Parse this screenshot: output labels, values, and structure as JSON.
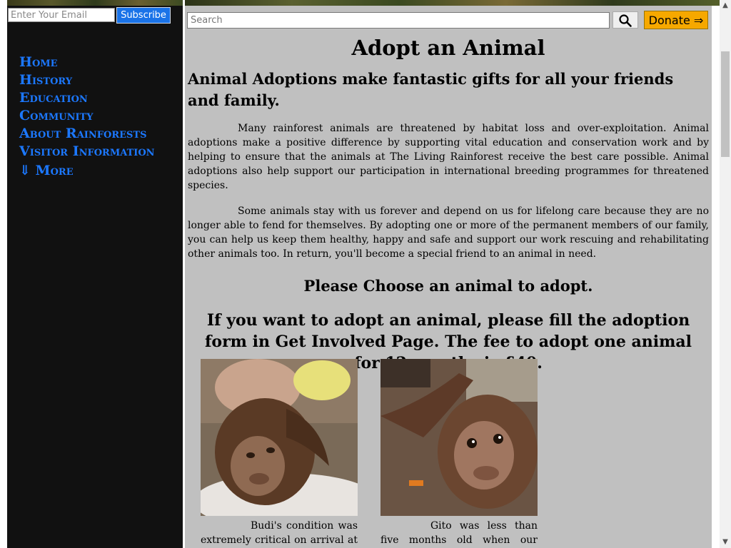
{
  "sidebar": {
    "subscribe": {
      "email_placeholder": "Enter Your Email",
      "button_label": "Subscribe"
    },
    "nav": {
      "items": [
        {
          "label": "Home"
        },
        {
          "label": "History"
        },
        {
          "label": "Education"
        },
        {
          "label": "Community"
        },
        {
          "label": "About Rainforests"
        },
        {
          "label": "Visitor Information"
        }
      ],
      "more_label": "⇓ More"
    }
  },
  "header": {
    "search_placeholder": "Search",
    "search_icon": "search-icon",
    "donate_label": "Donate ⇒"
  },
  "main": {
    "title": "Adopt an Animal",
    "subtitle": "Animal Adoptions make fantastic gifts for all your friends and family.",
    "paragraphs": [
      "Many rainforest animals are threatened by habitat loss and over-exploitation. Animal adoptions make a positive difference by supporting vital education and conservation work and by helping to ensure that the animals at The Living Rainforest receive the best care possible. Animal adoptions also help support our participation in international breeding programmes for threatened species.",
      "Some animals stay with us forever and depend on us for lifelong care because they are no longer able to fend for themselves. By adopting one or more of the permanent members of our family, you can help us keep them healthy, happy and safe and support our work rescuing and rehabilitating other animals too. In return, you'll become a special friend to an animal in need."
    ],
    "choose_heading": "Please Choose an animal to adopt.",
    "instructions": "If you want to adopt an animal, please fill the adoption form in Get Involved Page. The fee to adopt one animal for 12 months is £40.",
    "animals": [
      {
        "caption": "Budi's condition was extremely critical on arrival at the"
      },
      {
        "caption": "Gito was less than five months old when our rescue team"
      }
    ]
  },
  "colors": {
    "sidebar_bg": "#111111",
    "nav_link": "#1c78ff",
    "main_bg": "#c0c0c0",
    "subscribe_bg": "#1a73e8",
    "donate_bg": "#f6a800"
  }
}
